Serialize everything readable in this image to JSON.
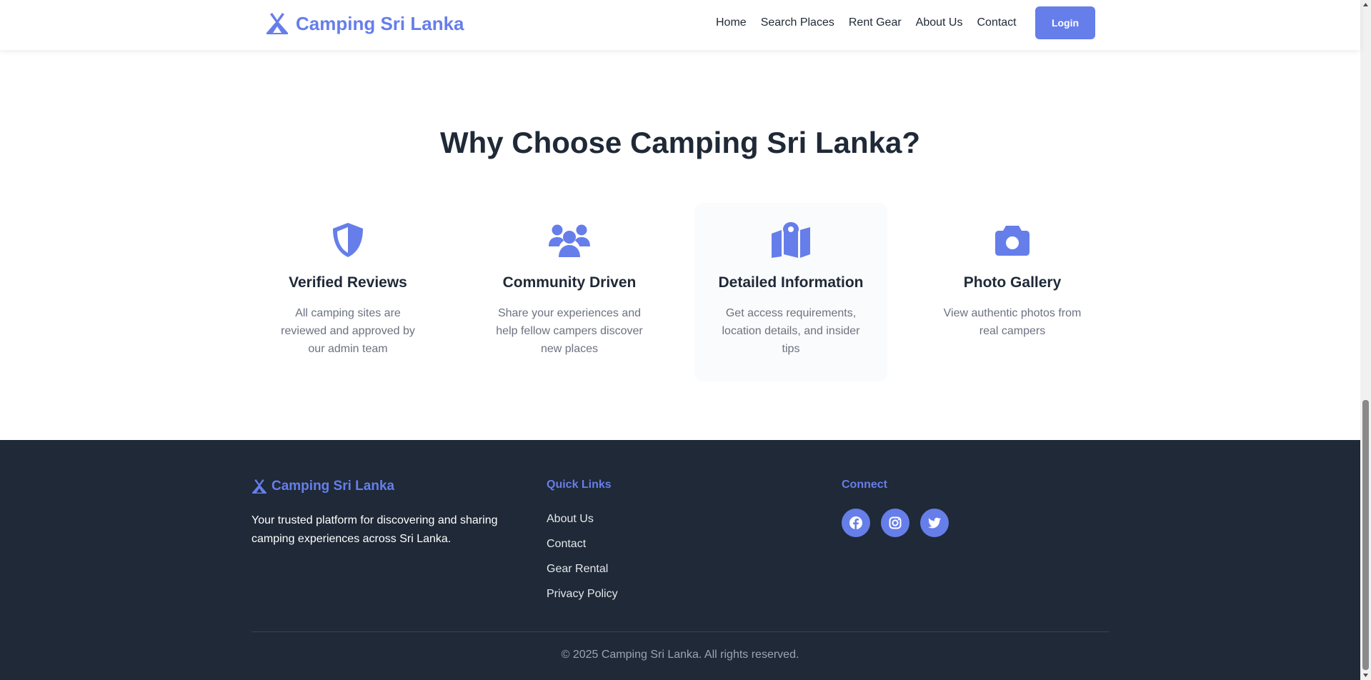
{
  "nav": {
    "brand": "Camping Sri Lanka",
    "links": [
      "Home",
      "Search Places",
      "Rent Gear",
      "About Us",
      "Contact"
    ],
    "login": "Login"
  },
  "features": {
    "title": "Why Choose Camping Sri Lanka?",
    "items": [
      {
        "icon": "shield-icon",
        "title": "Verified Reviews",
        "desc": "All camping sites are reviewed and approved by our admin team"
      },
      {
        "icon": "users-icon",
        "title": "Community Driven",
        "desc": "Share your experiences and help fellow campers discover new places"
      },
      {
        "icon": "map-location-icon",
        "title": "Detailed Information",
        "desc": "Get access requirements, location details, and insider tips"
      },
      {
        "icon": "camera-icon",
        "title": "Photo Gallery",
        "desc": "View authentic photos from real campers"
      }
    ]
  },
  "footer": {
    "brand": "Camping Sri Lanka",
    "description": "Your trusted platform for discovering and sharing camping experiences across Sri Lanka.",
    "quick_links_heading": "Quick Links",
    "quick_links": [
      "About Us",
      "Contact",
      "Gear Rental",
      "Privacy Policy"
    ],
    "connect_heading": "Connect",
    "socials": [
      "facebook-icon",
      "instagram-icon",
      "twitter-icon"
    ],
    "copyright": "© 2025 Camping Sri Lanka. All rights reserved."
  },
  "colors": {
    "accent": "#667eea",
    "text_dark": "#1f2937",
    "text_muted": "#6b7280",
    "footer_bg": "#1f2937"
  }
}
